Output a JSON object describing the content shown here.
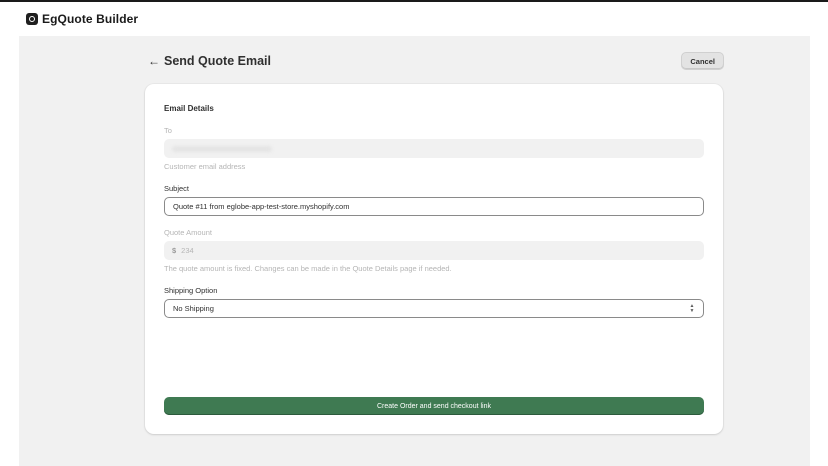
{
  "app": {
    "title": "EgQuote Builder"
  },
  "header": {
    "title": "Send Quote Email",
    "cancel_label": "Cancel"
  },
  "form": {
    "section_title": "Email Details",
    "to": {
      "label": "To",
      "help": "Customer email address"
    },
    "subject": {
      "label": "Subject",
      "value": "Quote #11 from eglobe-app-test-store.myshopify.com"
    },
    "quote_amount": {
      "label": "Quote Amount",
      "currency": "$",
      "value": "234",
      "help": "The quote amount is fixed. Changes can be made in the Quote Details page if needed."
    },
    "shipping": {
      "label": "Shipping Option",
      "selected": "No Shipping"
    },
    "submit_label": "Create Order and send checkout link"
  },
  "colors": {
    "primary": "#3f7a52",
    "canvas": "#f1f1f1"
  }
}
